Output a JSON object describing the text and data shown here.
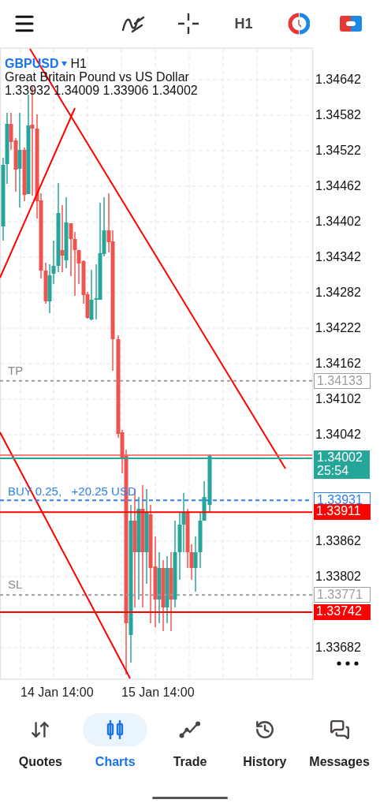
{
  "top_bar": {
    "timeframe": "H1"
  },
  "symbol": {
    "name": "GBPUSD",
    "timeframe": "H1",
    "description": "Great Britain Pound vs US Dollar",
    "ohlc": "1.33932 1.34009 1.33906 1.34002"
  },
  "price_ticks": [
    "1.34642",
    "1.34582",
    "1.34522",
    "1.34462",
    "1.34402",
    "1.34342",
    "1.34282",
    "1.34222",
    "1.34162",
    "1.34102",
    "1.34042",
    "1.33862",
    "1.33802",
    "1.33682"
  ],
  "levels": [
    {
      "kind": "tp",
      "label": "TP",
      "price": "1.34133"
    },
    {
      "kind": "bid",
      "price": "1.34002",
      "countdown": "25:54"
    },
    {
      "kind": "position",
      "label": "BUY 0.25,   +20.25 USD",
      "price": "1.33931"
    },
    {
      "kind": "line",
      "price": "1.33911"
    },
    {
      "kind": "sl",
      "label": "SL",
      "price": "1.33771"
    },
    {
      "kind": "line",
      "price": "1.33742"
    }
  ],
  "time_axis": [
    "14 Jan 14:00",
    "15 Jan 14:00"
  ],
  "nav": [
    {
      "kind": "quotes",
      "label": "Quotes",
      "selected": false
    },
    {
      "kind": "charts",
      "label": "Charts",
      "selected": true
    },
    {
      "kind": "trade",
      "label": "Trade",
      "selected": false
    },
    {
      "kind": "history",
      "label": "History",
      "selected": false
    },
    {
      "kind": "messages",
      "label": "Messages",
      "selected": false
    }
  ]
}
